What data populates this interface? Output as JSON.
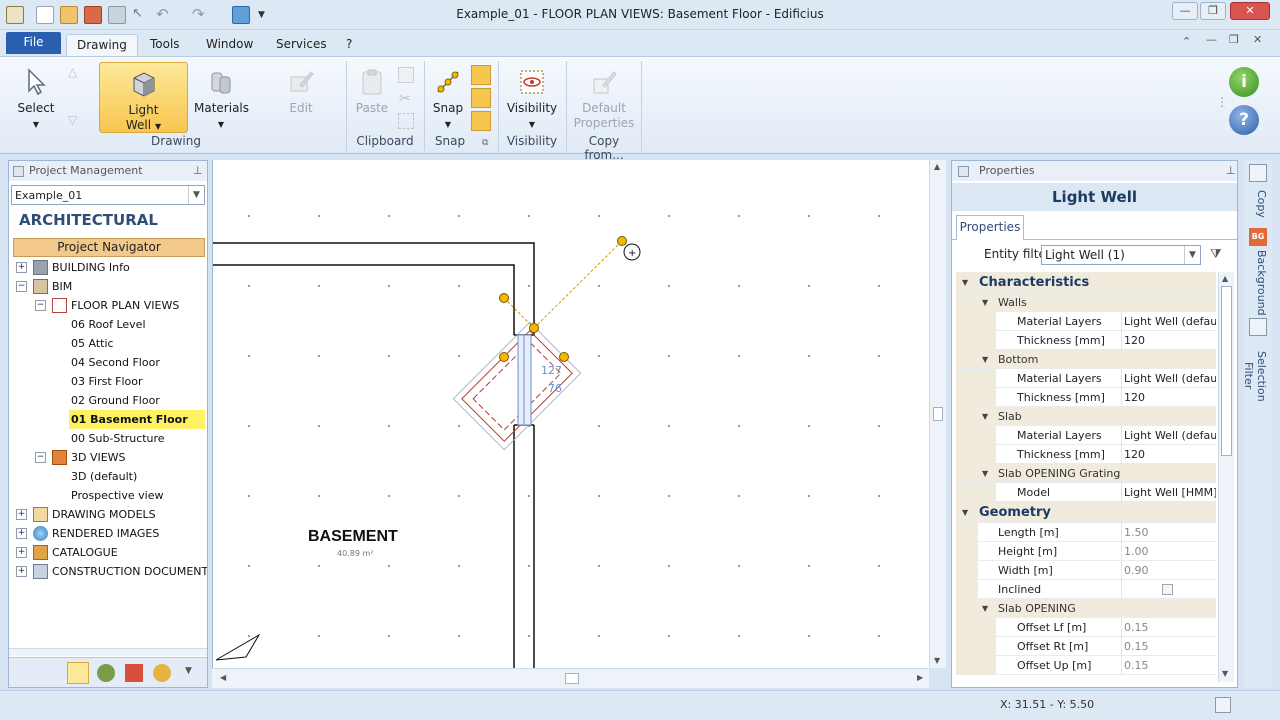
{
  "window": {
    "title": "Example_01 -  FLOOR PLAN VIEWS: Basement Floor - Edificius",
    "minimize": "—",
    "maximize": "❐",
    "close": "✕"
  },
  "menu": {
    "file": "File",
    "tabs": [
      "Drawing",
      "Tools",
      "Window",
      "Services",
      "?"
    ]
  },
  "ribbon": {
    "select": "Select",
    "light_well_line1": "Light",
    "light_well_line2": "Well",
    "materials": "Materials",
    "edit": "Edit",
    "paste": "Paste",
    "snap": "Snap",
    "visibility": "Visibility",
    "default_properties_line1": "Default",
    "default_properties_line2": "Properties",
    "groups": {
      "drawing": "Drawing",
      "clipboard": "Clipboard",
      "snap": "Snap",
      "visibility": "Visibility",
      "copy_from": "Copy from..."
    }
  },
  "project_panel": {
    "header": "Project Management",
    "project_selected": "Example_01",
    "section_title": "ARCHITECTURAL",
    "navigator_button": "Project Navigator",
    "tree": [
      {
        "label": "BUILDING Info",
        "level": 0,
        "exp": "+"
      },
      {
        "label": "BIM",
        "level": 0,
        "exp": "−"
      },
      {
        "label": "FLOOR PLAN VIEWS",
        "level": 1,
        "exp": "−"
      },
      {
        "label": "06 Roof Level",
        "level": 2
      },
      {
        "label": "05 Attic",
        "level": 2
      },
      {
        "label": "04 Second Floor",
        "level": 2
      },
      {
        "label": "03 First Floor",
        "level": 2
      },
      {
        "label": "02 Ground Floor",
        "level": 2
      },
      {
        "label": "01 Basement Floor",
        "level": 2
      },
      {
        "label": "00 Sub-Structure",
        "level": 2
      },
      {
        "label": "3D VIEWS",
        "level": 1,
        "exp": "−"
      },
      {
        "label": "3D (default)",
        "level": 2
      },
      {
        "label": "Prospective view",
        "level": 2
      },
      {
        "label": "DRAWING MODELS",
        "level": 0,
        "exp": "+"
      },
      {
        "label": "RENDERED IMAGES",
        "level": 0,
        "exp": "+"
      },
      {
        "label": "CATALOGUE",
        "level": 0,
        "exp": "+"
      },
      {
        "label": "CONSTRUCTION DOCUMENTS S",
        "level": 0,
        "exp": "+"
      }
    ]
  },
  "canvas": {
    "room_name": "BASEMENT",
    "room_area": "40.89 m²",
    "dim_1": "127",
    "dim_2": "76"
  },
  "properties_panel": {
    "header": "Properties",
    "title": "Light Well",
    "tab": "Properties",
    "entity_filter_label": "Entity filter",
    "entity_filter_value": "Light Well (1)",
    "characteristics": "Characteristics",
    "walls": "Walls",
    "walls_material_label": "Material Layers",
    "walls_material_value": "Light Well (default)",
    "walls_thickness_label": "Thickness  [mm]",
    "walls_thickness_value": "120",
    "bottom": "Bottom",
    "bottom_material_label": "Material Layers",
    "bottom_material_value": "Light Well (default)",
    "bottom_thickness_label": "Thickness  [mm]",
    "bottom_thickness_value": "120",
    "slab": "Slab",
    "slab_material_label": "Material Layers",
    "slab_material_value": "Light Well (default)",
    "slab_thickness_label": "Thickness  [mm]",
    "slab_thickness_value": "120",
    "grating": "Slab OPENING Grating",
    "model_label": "Model",
    "model_value": "Light Well [HMM] (C",
    "geometry": "Geometry",
    "length_label": "Length  [m]",
    "length_value": "1.50",
    "height_label": "Height  [m]",
    "height_value": "1.00",
    "width_label": "Width  [m]",
    "width_value": "0.90",
    "inclined_label": "Inclined",
    "opening": "Slab OPENING",
    "offset_lf_label": "Offset Lf  [m]",
    "offset_lf_value": "0.15",
    "offset_rt_label": "Offset Rt  [m]",
    "offset_rt_value": "0.15",
    "offset_up_label": "Offset Up  [m]",
    "offset_up_value": "0.15"
  },
  "side_tabs": {
    "copy": "Copy",
    "background": "Background",
    "selection_filter": "Selection Filter"
  },
  "status": {
    "coords": "X: 31.51 - Y: 5.50"
  },
  "colors": {
    "accent": "#2a5fb0",
    "selected_button": "#f7c64f",
    "tree_highlight": "#fff166",
    "handle": "#f5b800"
  }
}
